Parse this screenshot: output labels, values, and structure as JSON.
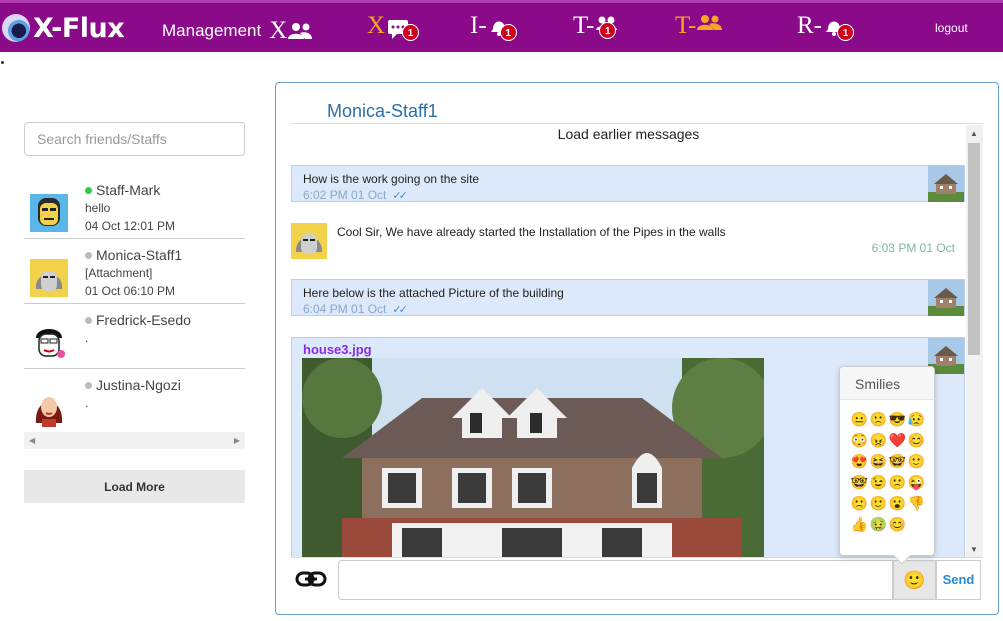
{
  "app": {
    "logo_text": "X-Flux"
  },
  "nav": {
    "management_label": "Management",
    "management_letter": "X",
    "items": [
      {
        "letter": "X",
        "badge": "1",
        "icon": "chat-icon"
      },
      {
        "letter": "I-",
        "badge": "1",
        "icon": "bell-icon"
      },
      {
        "letter": "T-",
        "badge": "1",
        "icon": "group-icon"
      },
      {
        "letter": "T-",
        "badge": "",
        "icon": "people-icon"
      },
      {
        "letter": "R-",
        "badge": "1",
        "icon": "bell-icon"
      }
    ],
    "logout_label": "logout"
  },
  "sidebar": {
    "search_placeholder": "Search friends/Staffs",
    "contacts": [
      {
        "name": "Staff-Mark",
        "status": "online",
        "message": "hello",
        "time": "04 Oct 12:01 PM"
      },
      {
        "name": "Monica-Staff1",
        "status": "offline",
        "message": "[Attachment]",
        "time": "01 Oct 06:10 PM"
      },
      {
        "name": "Fredrick-Esedo",
        "status": "offline",
        "message": ".",
        "time": ""
      },
      {
        "name": "Justina-Ngozi",
        "status": "offline",
        "message": ".",
        "time": ""
      }
    ],
    "load_more_label": "Load More"
  },
  "chat": {
    "title": "Monica-Staff1",
    "load_earlier_label": "Load earlier messages",
    "messages": [
      {
        "direction": "out",
        "text": "How is the work going on the site",
        "time": "6:02 PM 01 Oct"
      },
      {
        "direction": "in",
        "text": "Cool Sir, We have already started the Installation of the Pipes in the walls",
        "time": "6:03 PM 01 Oct"
      },
      {
        "direction": "out",
        "text": "Here below is the attached Picture of the building",
        "time": "6:04 PM 01 Oct"
      },
      {
        "direction": "out",
        "attachment": "house3.jpg"
      }
    ],
    "input_value": "",
    "send_label": "Send"
  },
  "smilies": {
    "title": "Smilies",
    "items": [
      "😐",
      "🙁",
      "😎",
      "😥",
      "😳",
      "😠",
      "❤️",
      "😊",
      "😍",
      "😆",
      "🤓",
      "🙂",
      "🤓",
      "😉",
      "🙁",
      "😜",
      "🙁",
      "🙂",
      "😮",
      "👎",
      "👍",
      "🤢",
      "😊"
    ]
  },
  "colors": {
    "topbar": "#8a0a8a",
    "accent_orange": "#f5a623",
    "badge": "#d0021b",
    "outgoing_bubble": "#dce9fa",
    "link_blue": "#2a6fa8"
  }
}
